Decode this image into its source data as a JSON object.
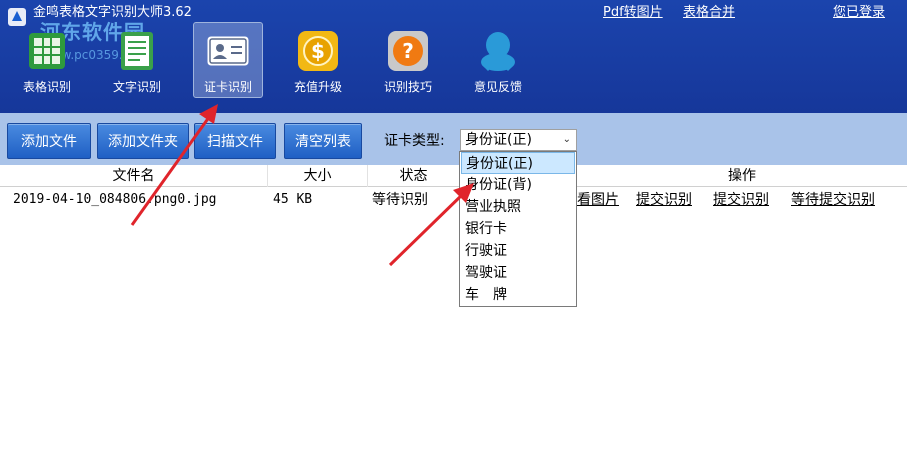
{
  "window": {
    "title": "金鸣表格文字识别大师3.62",
    "watermark": "河东软件园",
    "watermark_url": "www.pc0359.cn"
  },
  "top_links": {
    "pdf_to_image": "Pdf转图片",
    "table_merge": "表格合并",
    "login": "您已登录"
  },
  "tools": [
    {
      "label": "表格识别",
      "icon": "table-recognize-icon"
    },
    {
      "label": "文字识别",
      "icon": "text-recognize-icon"
    },
    {
      "label": "证卡识别",
      "icon": "card-recognize-icon",
      "selected": true
    },
    {
      "label": "充值升级",
      "icon": "coin-icon"
    },
    {
      "label": "识别技巧",
      "icon": "help-icon"
    },
    {
      "label": "意见反馈",
      "icon": "feedback-icon"
    }
  ],
  "toolbar": {
    "add_file": "添加文件",
    "add_folder": "添加文件夹",
    "scan_file": "扫描文件",
    "clear_list": "清空列表",
    "card_type_label": "证卡类型:",
    "card_type_value": "身份证(正)"
  },
  "table": {
    "headers": {
      "filename": "文件名",
      "size": "大小",
      "status": "状态",
      "actions": "操作"
    },
    "rows": [
      {
        "filename": "2019-04-10_084806.png0.jpg",
        "size": "45 KB",
        "status": "等待识别",
        "actions": [
          "看图片",
          "提交识别",
          "提交识别",
          "等待提交识别"
        ]
      }
    ]
  },
  "dropdown": {
    "options": [
      "身份证(正)",
      "身份证(背)",
      "营业执照",
      "银行卡",
      "行驶证",
      "驾驶证",
      "车　牌"
    ],
    "highlighted_index": 0
  },
  "colors": {
    "header_bg": "#1a3fa0",
    "toolbar_bg": "#a9c3e9",
    "button_bg": "#2f72d6",
    "annotation_arrow": "#e0242b"
  }
}
